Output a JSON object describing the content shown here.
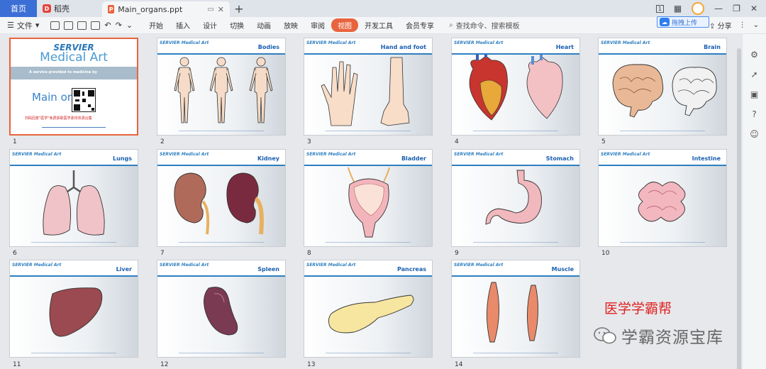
{
  "titlebar": {
    "home_tab": "首页",
    "daoke_tab": "稻壳",
    "doc_tab": "Main_organs.ppt",
    "page_indicator": "1"
  },
  "menubar": {
    "file": "文件",
    "items": [
      "开始",
      "插入",
      "设计",
      "切换",
      "动画",
      "放映",
      "审阅",
      "视图",
      "开发工具",
      "会员专享"
    ],
    "active_index": 7,
    "search": "查找命令、搜索模板",
    "share": "分享",
    "upload": "拖拽上传"
  },
  "slides": [
    {
      "num": "1",
      "title": ""
    },
    {
      "num": "2",
      "title": "Bodies"
    },
    {
      "num": "3",
      "title": "Hand and foot"
    },
    {
      "num": "4",
      "title": "Heart"
    },
    {
      "num": "5",
      "title": "Brain"
    },
    {
      "num": "6",
      "title": "Lungs"
    },
    {
      "num": "7",
      "title": "Kidney"
    },
    {
      "num": "8",
      "title": "Bladder"
    },
    {
      "num": "9",
      "title": "Stomach"
    },
    {
      "num": "10",
      "title": "Intestine"
    },
    {
      "num": "11",
      "title": "Liver"
    },
    {
      "num": "12",
      "title": "Spleen"
    },
    {
      "num": "13",
      "title": "Pancreas"
    },
    {
      "num": "14",
      "title": "Muscle"
    }
  ],
  "brand": "SERVIER Medical Art",
  "title_slide": {
    "servier": "SERVIER",
    "medical_art": "Medical Art",
    "tagline": "A service provided to medicine by",
    "main": "Main or",
    "red_note": "扫码回复\"医学\"免费获取医学素材资源合集"
  },
  "watermark": {
    "line1": "医学学霸帮",
    "line2": "学霸资源宝库"
  },
  "colors": {
    "accent": "#e8643d",
    "brand_blue": "#2d7fc1",
    "home_tab": "#3c6fd6"
  }
}
